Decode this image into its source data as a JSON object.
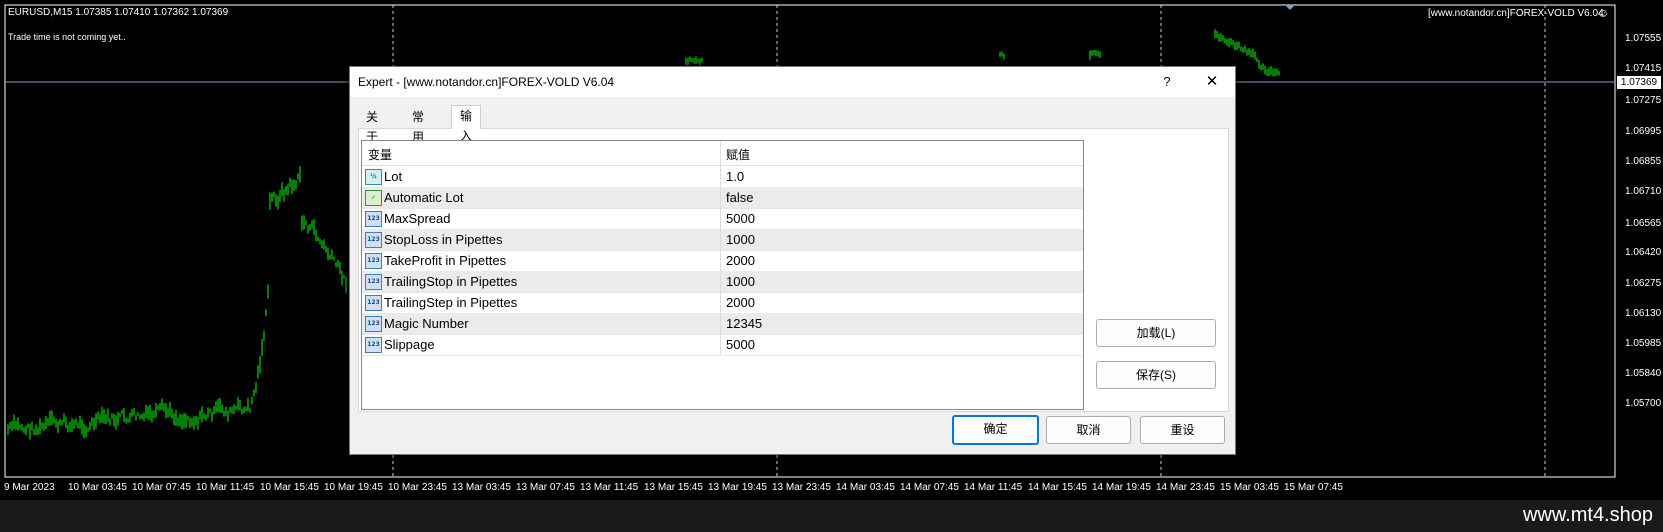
{
  "chart": {
    "symbol_info": "EURUSD,M15  1.07385 1.07410 1.07362 1.07369",
    "status_text": "Trade time is not coming yet..",
    "expert_label": "[www.notandor.cn]FOREX-VOLD V6.04",
    "current_price": "1.07369",
    "price_axis": [
      "1.07555",
      "1.07415",
      "1.07275",
      "1.06995",
      "1.06855",
      "1.06710",
      "1.06565",
      "1.06420",
      "1.06275",
      "1.06130",
      "1.05985",
      "1.05840",
      "1.05700"
    ],
    "time_axis": [
      "9 Mar 2023",
      "10 Mar 03:45",
      "10 Mar 07:45",
      "10 Mar 11:45",
      "10 Mar 15:45",
      "10 Mar 19:45",
      "10 Mar 23:45",
      "13 Mar 03:45",
      "13 Mar 07:45",
      "13 Mar 11:45",
      "13 Mar 15:45",
      "13 Mar 19:45",
      "13 Mar 23:45",
      "14 Mar 03:45",
      "14 Mar 07:45",
      "14 Mar 11:45",
      "14 Mar 15:45",
      "14 Mar 19:45",
      "14 Mar 23:45",
      "15 Mar 03:45",
      "15 Mar 07:45"
    ],
    "colors": {
      "background": "#000000",
      "candles": "#00ff00",
      "grid": "#ffffff",
      "bid_line": "#7f9fbf"
    }
  },
  "dialog": {
    "title": "Expert - [www.notandor.cn]FOREX-VOLD V6.04",
    "help_label": "?",
    "close_label": "✕",
    "tabs": [
      {
        "label": "关于",
        "active": false
      },
      {
        "label": "常用",
        "active": false
      },
      {
        "label": "输入参数",
        "active": true
      }
    ],
    "table": {
      "headers": [
        "变量",
        "赋值"
      ],
      "rows": [
        {
          "icon": "double-type-icon",
          "icon_text": "½",
          "name": "Lot",
          "value": "1.0"
        },
        {
          "icon": "bool-type-icon",
          "icon_text": "✓",
          "name": "Automatic Lot",
          "value": "false"
        },
        {
          "icon": "int-type-icon",
          "icon_text": "123",
          "name": "MaxSpread",
          "value": "5000"
        },
        {
          "icon": "int-type-icon",
          "icon_text": "123",
          "name": "StopLoss in Pipettes",
          "value": "1000"
        },
        {
          "icon": "int-type-icon",
          "icon_text": "123",
          "name": "TakeProfit in Pipettes",
          "value": "2000"
        },
        {
          "icon": "int-type-icon",
          "icon_text": "123",
          "name": "TrailingStop in Pipettes",
          "value": "1000"
        },
        {
          "icon": "int-type-icon",
          "icon_text": "123",
          "name": "TrailingStep in Pipettes",
          "value": "2000"
        },
        {
          "icon": "int-type-icon",
          "icon_text": "123",
          "name": "Magic Number",
          "value": "12345"
        },
        {
          "icon": "int-type-icon",
          "icon_text": "123",
          "name": "Slippage",
          "value": "5000"
        }
      ]
    },
    "buttons": {
      "load": "加载(L)",
      "save": "保存(S)",
      "ok": "确定",
      "cancel": "取消",
      "reset": "重设"
    }
  },
  "footer": {
    "site": "www.mt4.shop"
  }
}
